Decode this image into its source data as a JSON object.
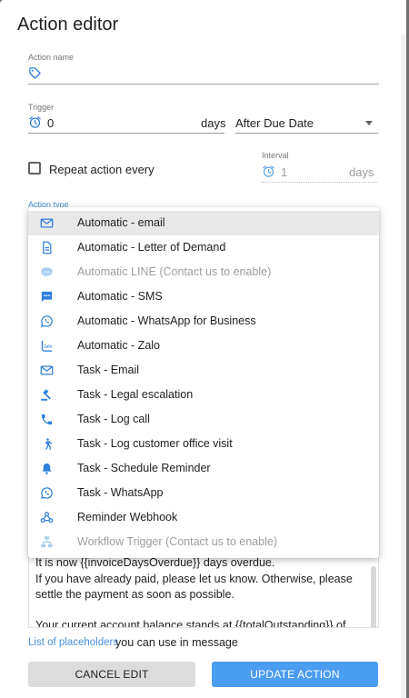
{
  "dialog": {
    "title": "Action editor"
  },
  "action_name": {
    "label": "Action name",
    "value": "",
    "icon": "tag-icon"
  },
  "trigger": {
    "label": "Trigger",
    "value": "0",
    "unit": "days",
    "relation": "After Due Date",
    "icon": "alarm-clock-icon"
  },
  "repeat": {
    "checkbox_label": "Repeat action every",
    "checked": false
  },
  "interval": {
    "label": "Interval",
    "value": "1",
    "unit": "days",
    "icon": "alarm-clock-icon"
  },
  "action_type": {
    "label": "Action type"
  },
  "menu": {
    "items": [
      {
        "label": "Automatic - email",
        "icon": "email-icon",
        "selected": true,
        "disabled": false
      },
      {
        "label": "Automatic - Letter of Demand",
        "icon": "document-icon",
        "selected": false,
        "disabled": false
      },
      {
        "label": "Automatic LINE (Contact us to enable)",
        "icon": "line-chat-icon",
        "selected": false,
        "disabled": true
      },
      {
        "label": "Automatic - SMS",
        "icon": "sms-icon",
        "selected": false,
        "disabled": false
      },
      {
        "label": "Automatic - WhatsApp for Business",
        "icon": "whatsapp-icon",
        "selected": false,
        "disabled": false
      },
      {
        "label": "Automatic - Zalo",
        "icon": "zalo-icon",
        "selected": false,
        "disabled": false
      },
      {
        "label": "Task - Email",
        "icon": "email-icon",
        "selected": false,
        "disabled": false
      },
      {
        "label": "Task - Legal escalation",
        "icon": "gavel-icon",
        "selected": false,
        "disabled": false
      },
      {
        "label": "Task - Log call",
        "icon": "phone-icon",
        "selected": false,
        "disabled": false
      },
      {
        "label": "Task - Log customer office visit",
        "icon": "walking-person-icon",
        "selected": false,
        "disabled": false
      },
      {
        "label": "Task - Schedule Reminder",
        "icon": "bell-icon",
        "selected": false,
        "disabled": false
      },
      {
        "label": "Task - WhatsApp",
        "icon": "whatsapp-icon",
        "selected": false,
        "disabled": false
      },
      {
        "label": "Reminder Webhook",
        "icon": "webhook-icon",
        "selected": false,
        "disabled": false
      },
      {
        "label": "Workflow Trigger (Contact us to enable)",
        "icon": "workflow-icon",
        "selected": false,
        "disabled": true
      }
    ]
  },
  "message": {
    "lines": [
      "It is now {{invoiceDaysOverdue}} days overdue.",
      "If you have already paid, please let us know. Otherwise, please",
      "settle the payment as soon as possible.",
      "Your current account balance stands at {{totalOutstanding}} of"
    ]
  },
  "placeholders": {
    "link": "List of placeholders",
    "rest": "you can use in message"
  },
  "buttons": {
    "cancel": "CANCEL EDIT",
    "update": "UPDATE ACTION"
  },
  "colors": {
    "accent": "#4a9df0",
    "link": "#4a90d9",
    "icon_blue": "#2f7fdc"
  }
}
